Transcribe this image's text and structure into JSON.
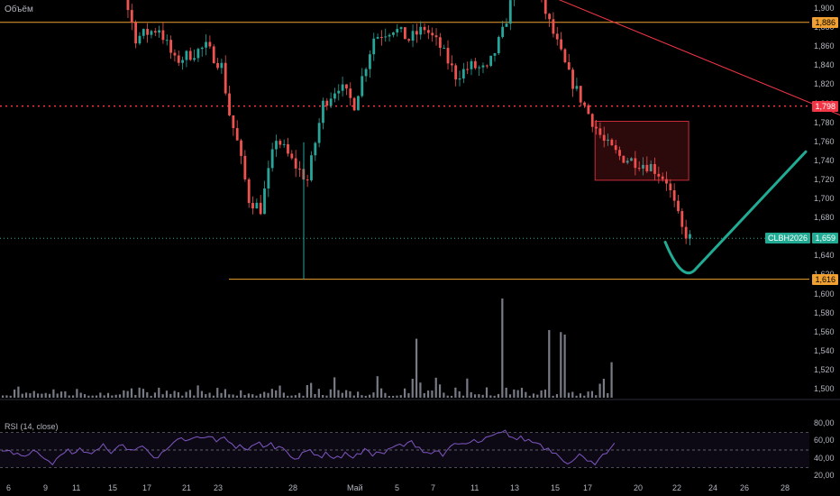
{
  "panes": {
    "volume_label": "Объём",
    "rsi_label": "RSI (14, close)"
  },
  "price_axis": {
    "ticks": [
      "1,900",
      "1,880",
      "1,860",
      "1,840",
      "1,820",
      "1,800",
      "1,780",
      "1,760",
      "1,740",
      "1,720",
      "1,700",
      "1,680",
      "1,660",
      "1,640",
      "1,620",
      "1,600",
      "1,580",
      "1,560",
      "1,540",
      "1,520",
      "1,500"
    ],
    "tags": [
      {
        "value": "1,886",
        "bg": "#f0a030",
        "fg": "#000000"
      },
      {
        "value": "1,798",
        "bg": "#f23645",
        "fg": "#ffffff"
      },
      {
        "value": "1,659",
        "bg": "#22ab94",
        "fg": "#ffffff"
      },
      {
        "value": "1,616",
        "bg": "#f0a030",
        "fg": "#000000"
      }
    ],
    "symbol_tag": {
      "label": "CLBH2026",
      "bg": "#22ab94",
      "fg": "#ffffff"
    }
  },
  "rsi_axis": {
    "ticks": [
      "80,00",
      "60,00",
      "40,00",
      "20,00"
    ]
  },
  "time_axis": {
    "ticks": [
      "6",
      "9",
      "11",
      "15",
      "17",
      "21",
      "23",
      "28",
      "Май",
      "5",
      "7",
      "11",
      "13",
      "15",
      "17",
      "20",
      "22",
      "24",
      "26",
      "28"
    ]
  },
  "chart_data": {
    "type": "candlestick",
    "ylim": [
      1600,
      1910
    ],
    "horizontal_levels": [
      {
        "value": 1886,
        "style": "solid",
        "color": "#f0a030"
      },
      {
        "value": 1798,
        "style": "dotted",
        "color": "#f23645"
      },
      {
        "value": 1659,
        "style": "dotted",
        "color": "#22ab94"
      },
      {
        "value": 1616,
        "style": "solid",
        "color": "#f0a030"
      }
    ],
    "trendline": {
      "color": "#f23645",
      "from": {
        "x_index": 132,
        "y": 1928
      },
      "to": {
        "x_index": 227,
        "y": 1768
      }
    },
    "box": {
      "color": "#f23645",
      "x_index": [
        152,
        176
      ],
      "y": [
        1720,
        1782
      ]
    },
    "projection": {
      "color": "#22ab94",
      "points": [
        {
          "x_index": 170,
          "y": 1655
        },
        {
          "x_index": 176,
          "y": 1625
        },
        {
          "x_index": 206,
          "y": 1750
        }
      ]
    },
    "last_price": 1659,
    "volume_colors": {
      "bar": "#787b86"
    },
    "rsi": {
      "upper": 70,
      "middle": 50,
      "lower": 30,
      "line_color": "#7e57c2"
    }
  }
}
